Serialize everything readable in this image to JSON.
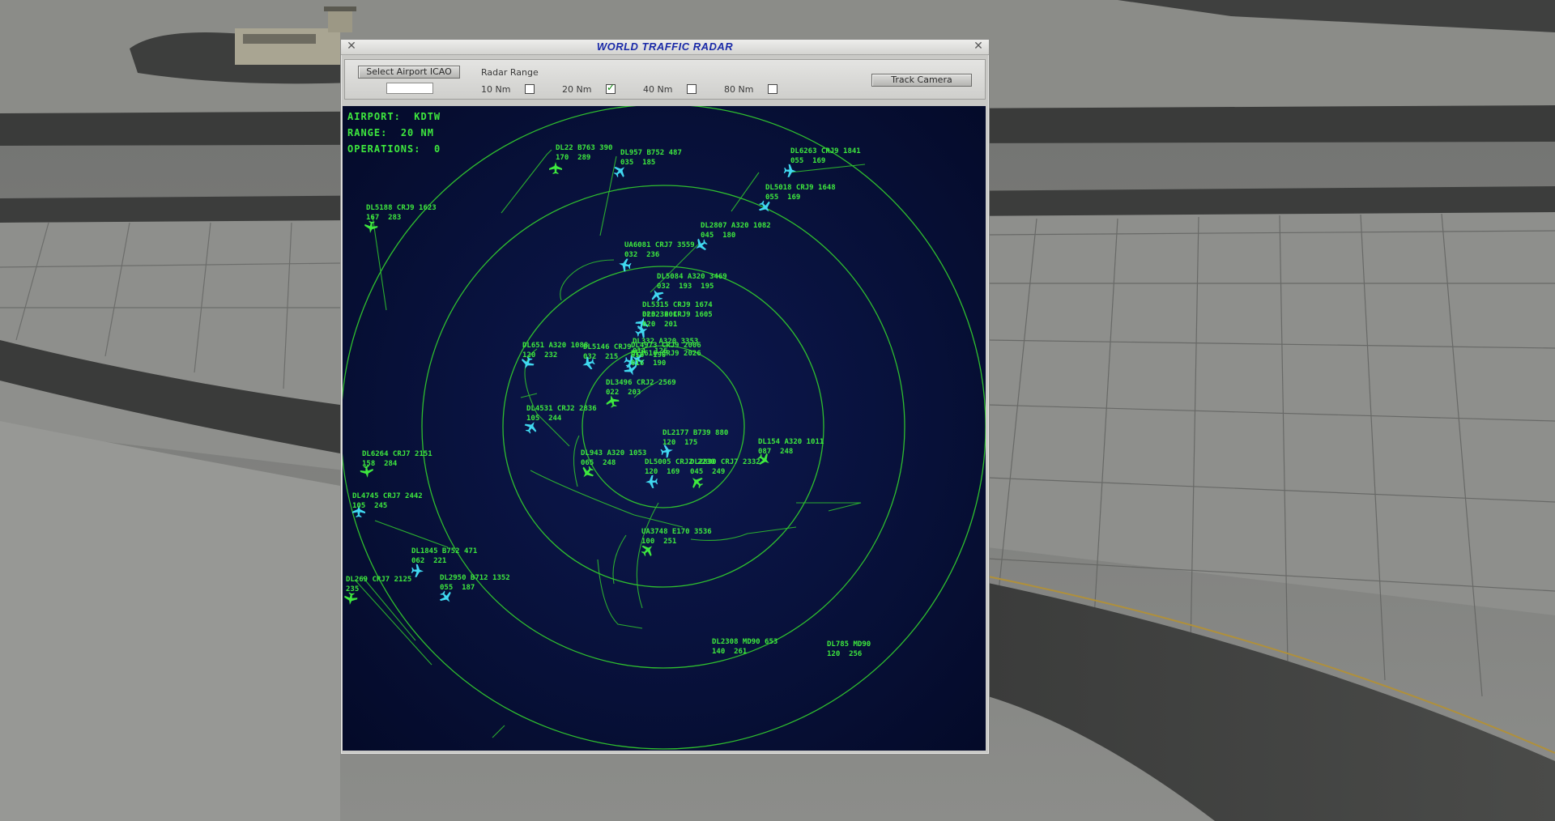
{
  "window": {
    "title": "WORLD TRAFFIC RADAR",
    "close_symbol": "✕"
  },
  "toolbar": {
    "select_airport_label": "Select Airport ICAO",
    "icao_value": "",
    "radar_range_label": "Radar Range",
    "range_options": [
      {
        "label": "10 Nm",
        "checked": false
      },
      {
        "label": "20 Nm",
        "checked": true
      },
      {
        "label": "40 Nm",
        "checked": false
      },
      {
        "label": "80 Nm",
        "checked": false
      }
    ],
    "track_camera_label": "Track Camera"
  },
  "radar": {
    "airport_label": "AIRPORT:",
    "airport_value": "KDTW",
    "range_label": "RANGE:",
    "range_value": "20 NM",
    "operations_label": "OPERATIONS:",
    "operations_value": "0",
    "colors": {
      "ring": "#2fbf2f",
      "text": "#3ee83e",
      "aircraft_cyan": "#40d8f0",
      "aircraft_green": "#3ee83e",
      "background": "#071038"
    },
    "aircraft": [
      {
        "line1": "DL22 B763 390",
        "line2": "170  289",
        "icon_color": "green"
      },
      {
        "line1": "DL957 B752 487",
        "line2": "035  185",
        "icon_color": "cyan"
      },
      {
        "line1": "DL6263 CRJ9 1841",
        "line2": "055  169",
        "icon_color": "cyan"
      },
      {
        "line1": "DL5018 CRJ9 1648",
        "line2": "055  169",
        "icon_color": "cyan"
      },
      {
        "line1": "DL5188 CRJ9 1623",
        "line2": "167  283",
        "icon_color": "green"
      },
      {
        "line1": "DL2807 A320 1082",
        "line2": "045  180",
        "icon_color": "cyan"
      },
      {
        "line1": "UA6081 CRJ7 3559",
        "line2": "032  236",
        "icon_color": "cyan"
      },
      {
        "line1": "DL5084 A320 3469",
        "line2": "032  193  195",
        "icon_color": "cyan"
      },
      {
        "line1": "DL5315 CRJ9 1674",
        "line2": "020  201",
        "icon_color": "cyan"
      },
      {
        "line1": "DL3236 CRJ9 1605",
        "line2": "020  201",
        "icon_color": "cyan"
      },
      {
        "line1": "DL4973 CRJ9 2006",
        "line2": "016  190",
        "icon_color": "cyan"
      },
      {
        "line1": "DL3616 CRJ9 2026",
        "line2": "016  190",
        "icon_color": "cyan"
      },
      {
        "line1": "DL651 A320 1088",
        "line2": "120  232",
        "icon_color": "cyan"
      },
      {
        "line1": "DL5146 CRJ9",
        "line2": "032  215",
        "icon_color": "cyan"
      },
      {
        "line1": "DL332 A320 3353",
        "line2": "014  126",
        "icon_color": "cyan"
      },
      {
        "line1": "DL3496 CRJ2 2569",
        "line2": "022  203",
        "icon_color": "green"
      },
      {
        "line1": "DL4531 CRJ2 2836",
        "line2": "105  244",
        "icon_color": "cyan"
      },
      {
        "line1": "DL2177 B739 880",
        "line2": "120  175",
        "icon_color": "cyan"
      },
      {
        "line1": "DL154 A320 1011",
        "line2": "087  248",
        "icon_color": "green"
      },
      {
        "line1": "DL6264 CRJ7 2151",
        "line2": "158  284",
        "icon_color": "green"
      },
      {
        "line1": "DL943 A320 1053",
        "line2": "065  248",
        "icon_color": "green"
      },
      {
        "line1": "DL5005 CRJ2 2230",
        "line2": "120  169",
        "icon_color": "cyan"
      },
      {
        "line1": "DL2830 CRJ7 2332",
        "line2": "045  249",
        "icon_color": "green"
      },
      {
        "line1": "DL4745 CRJ7 2442",
        "line2": "105  245",
        "icon_color": "cyan"
      },
      {
        "line1": "UA3748 E170 3536",
        "line2": "100  251",
        "icon_color": "green"
      },
      {
        "line1": "DL1845 B752 471",
        "line2": "062  221",
        "icon_color": "cyan"
      },
      {
        "line1": "DL2950 B712 1352",
        "line2": "055  187",
        "icon_color": "cyan"
      },
      {
        "line1": "DL269 CRJ7 2125",
        "line2": "235",
        "icon_color": "green"
      },
      {
        "line1": "DL2308 MD90 653",
        "line2": "140  261",
        "icon_color": "green"
      },
      {
        "line1": "DL785 MD90",
        "line2": "120  256",
        "icon_color": "green"
      }
    ]
  }
}
